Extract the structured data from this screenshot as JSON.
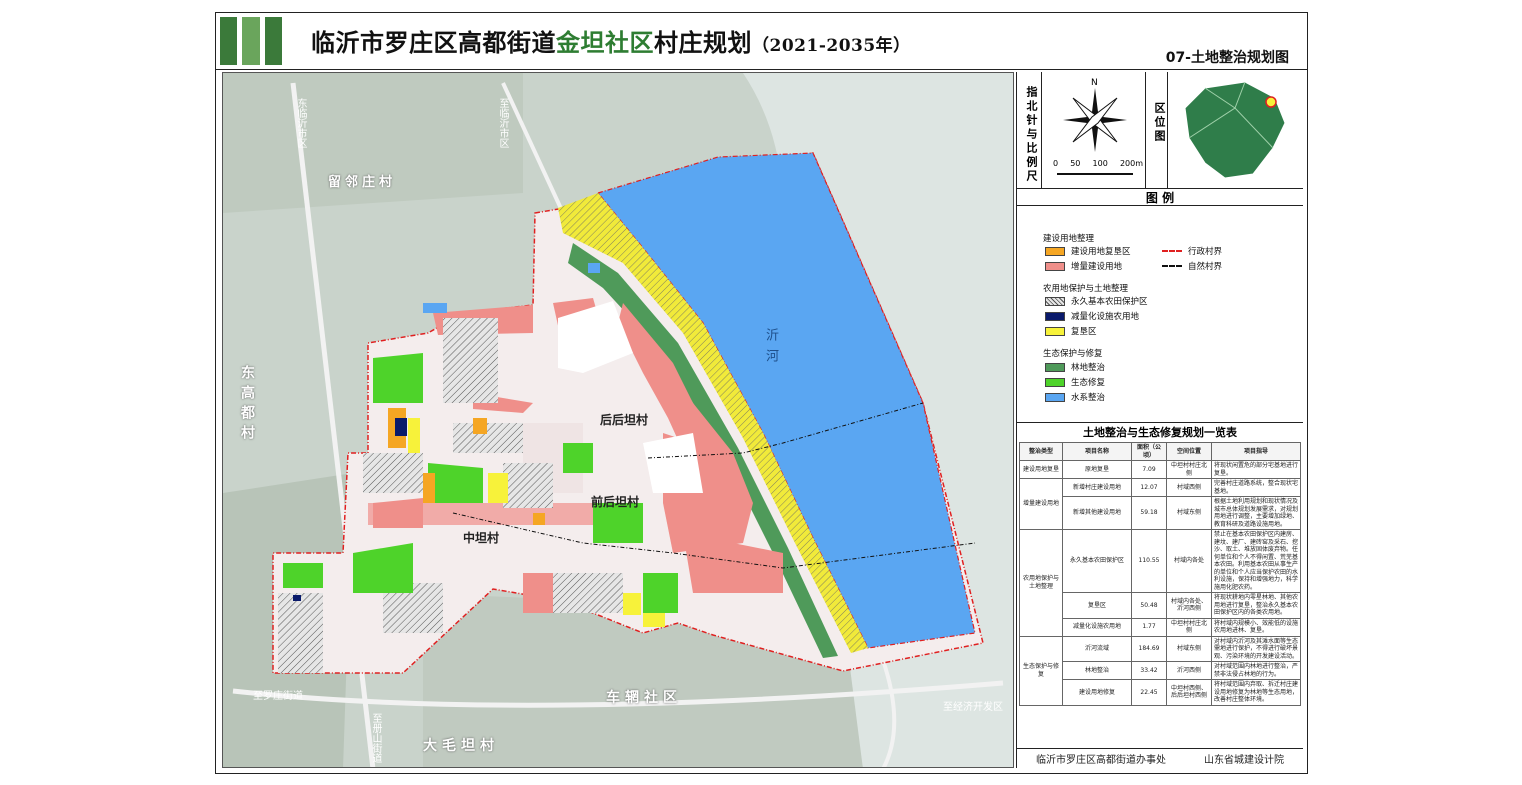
{
  "header": {
    "title_prefix": "临沂市罗庄区高都街道",
    "title_highlight": "金坦社区",
    "title_suffix": "村庄规划",
    "title_years": "（2021-2035年）",
    "subtitle": "07-土地整治规划图"
  },
  "map": {
    "roads": [
      "东临沂市区",
      "至临沂市区",
      "至罗庄街道",
      "至册山街道",
      "至经济开发区"
    ],
    "neighbor_labels": [
      "留邻庄村",
      "东高都村",
      "车辋社区",
      "大毛坦村"
    ],
    "village_labels": [
      "后后坦村",
      "前后坦村",
      "中坦村"
    ],
    "river_label": "沂河"
  },
  "side": {
    "compass_label": "指北针与比例尺",
    "north": "N",
    "scale_ticks": [
      "0",
      "50",
      "100",
      "200m"
    ],
    "location_label": "区位图",
    "legend_title": "图  例",
    "legend": {
      "group1": "建设用地整理",
      "g1_items": [
        "建设用地复垦区",
        "增量建设用地"
      ],
      "boundary_items": [
        "行政村界",
        "自然村界"
      ],
      "group2": "农用地保护与土地整理",
      "g2_items": [
        "永久基本农田保护区",
        "减量化设施农用地",
        "复垦区"
      ],
      "group3": "生态保护与修复",
      "g3_items": [
        "林地整治",
        "生态修复",
        "水系整治"
      ]
    },
    "colors": {
      "reclaim": "#f5a623",
      "increment": "#ef8f8a",
      "basic_farm": "#d0d0d0",
      "facility": "#0a1a6b",
      "reclaim_farm": "#f7f23a",
      "forest": "#4f9a5a",
      "eco": "#4ed32a",
      "water": "#5aa6f2",
      "admin_boundary": "#e02020",
      "natural_boundary": "#111111"
    }
  },
  "table": {
    "title": "土地整治与生态修复规划一览表",
    "headers": [
      "整治类型",
      "项目名称",
      "面积（公顷）",
      "空间位置",
      "项目指导"
    ],
    "rows": [
      {
        "type": "建设用地复垦",
        "name": "原地复垦",
        "area": "7.09",
        "loc": "中坦村村庄北侧",
        "desc": "将现状闲置危的部分宅基地进行复垦。"
      },
      {
        "type": "增量建设用地",
        "name": "新增村庄建设用地",
        "area": "12.07",
        "loc": "村域西侧",
        "desc": "完善村庄道路系统，整合现状宅基地。"
      },
      {
        "type": "",
        "name": "新增其他建设用地",
        "area": "59.18",
        "loc": "村域东侧",
        "desc": "根据土地利用规划和现状情况及城市总体规划发展需求，对规划用地进行调整，主要增加绿地、教育科研及道路设施用地。"
      },
      {
        "type": "农用地保护与土地整理",
        "name": "永久基本农田保护区",
        "area": "110.55",
        "loc": "村域内各处",
        "desc": "禁止在基本农田保护区内建房、建坟、建厂、建砖窑及采石、挖沙、取土、堆放固体废弃物。任何单位和个人不得闲置、荒芜基本农田。利用基本农田从事生产的单位和个人应当保护农田的水利设施，保持和增强地力，科学施用化肥农药。"
      },
      {
        "type": "",
        "name": "复垦区",
        "area": "50.48",
        "loc": "村域内各处、沂河西侧",
        "desc": "将现状耕地内零星林地、其他农用地进行复垦，整治永久基本农田保护区内的各类农用地。"
      },
      {
        "type": "",
        "name": "减量化设施农用地",
        "area": "1.77",
        "loc": "中坦村村庄北侧",
        "desc": "将村域内规模小、效能低的设施农用地进林、复垦。"
      },
      {
        "type": "生态保护与修复",
        "name": "沂河流域",
        "area": "184.69",
        "loc": "村域东侧",
        "desc": "对村域内沂河及其滩水面等生态需地进行保护，不得进行破坏景观、污染环境的开发建设活动。"
      },
      {
        "type": "",
        "name": "林地整治",
        "area": "33.42",
        "loc": "沂河西侧",
        "desc": "对村域范围内林地进行整治，严禁非法侵占林地的行为。"
      },
      {
        "type": "",
        "name": "建设用地修复",
        "area": "22.45",
        "loc": "中坦村西侧、后后坦村西侧",
        "desc": "将村域范围内弃取、拆迁村庄建设用地修复为林地等生态用地，改善村庄整体环境。"
      }
    ]
  },
  "footer": {
    "left": "临沂市罗庄区高都街道办事处",
    "right": "山东省城建设计院"
  }
}
